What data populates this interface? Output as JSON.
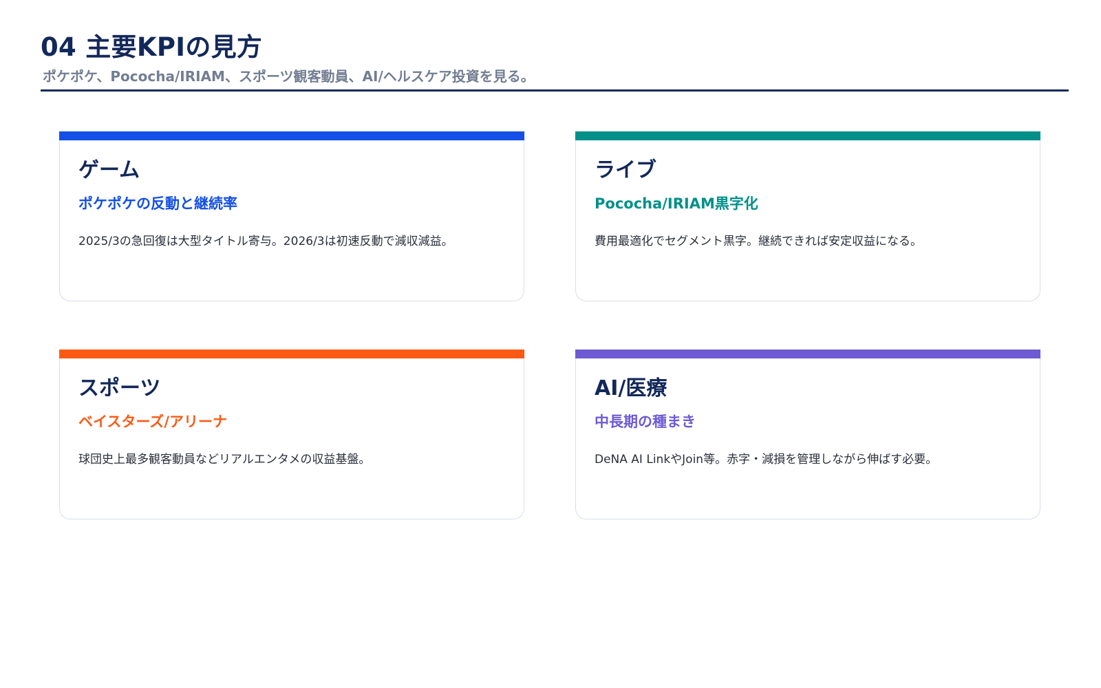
{
  "header": {
    "title": "04 主要KPIの見方",
    "subtitle": "ポケポケ、Pococha/IRIAM、スポーツ観客動員、AI/ヘルスケア投資を見る。"
  },
  "colors": {
    "navy": "#13285a",
    "subtitle_gray": "#737d92",
    "game": "#1450e6",
    "live": "#009089",
    "sports": "#fa5a14",
    "ai": "#6e5ad2"
  },
  "cards": [
    {
      "category": "ゲーム",
      "headline": "ポケポケの反動と継続率",
      "body": "2025/3の急回復は大型タイトル寄与。2026/3は初速反動で減収減益。",
      "accent": "#1450e6"
    },
    {
      "category": "ライブ",
      "headline": "Pococha/IRIAM黒字化",
      "body": "費用最適化でセグメント黒字。継続できれば安定収益になる。",
      "accent": "#009089"
    },
    {
      "category": "スポーツ",
      "headline": "ベイスターズ/アリーナ",
      "body": "球団史上最多観客動員などリアルエンタメの収益基盤。",
      "accent": "#fa5a14"
    },
    {
      "category": "AI/医療",
      "headline": "中長期の種まき",
      "body": "DeNA AI LinkやJoin等。赤字・減損を管理しながら伸ばす必要。",
      "accent": "#6e5ad2"
    }
  ]
}
